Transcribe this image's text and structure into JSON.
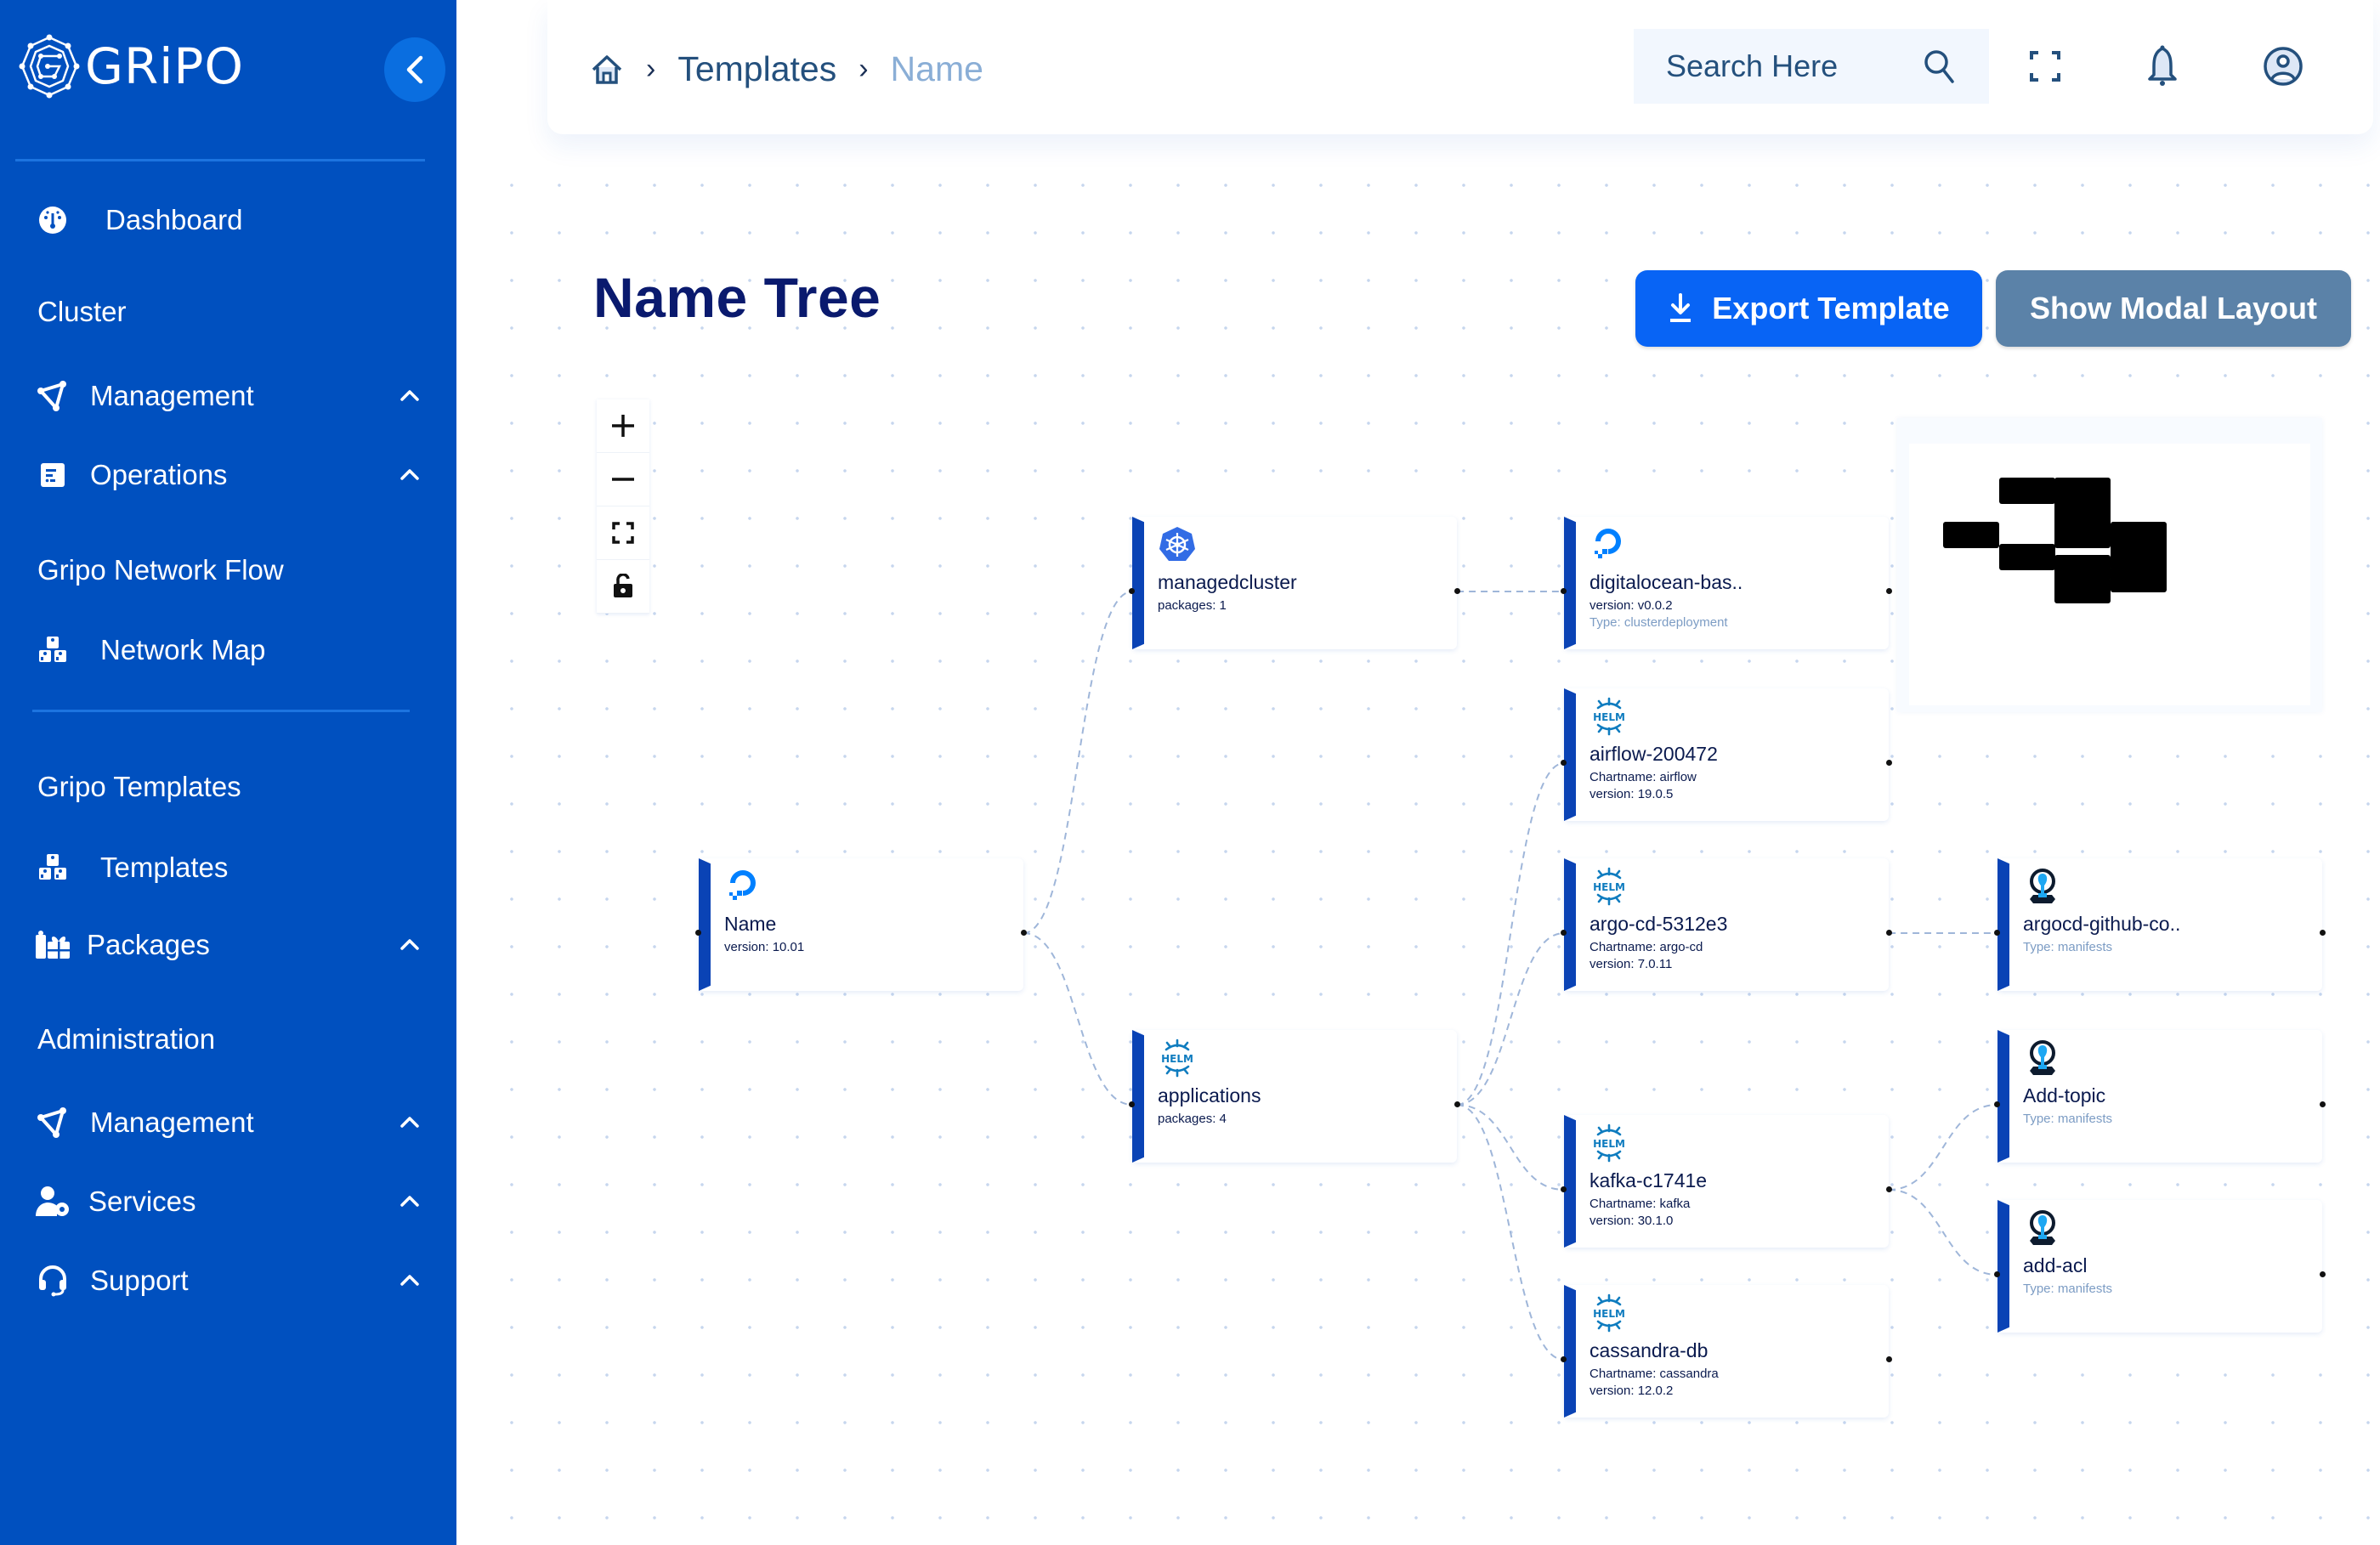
{
  "brand": {
    "name": "GRiPO"
  },
  "sidebar": {
    "dashboard": "Dashboard",
    "sections": {
      "cluster": "Cluster",
      "network_flow": "Gripo Network Flow",
      "templates": "Gripo Templates",
      "administration": "Administration"
    },
    "items": {
      "cluster_management": "Management",
      "operations": "Operations",
      "network_map": "Network Map",
      "templates": "Templates",
      "packages": "Packages",
      "admin_management": "Management",
      "services": "Services",
      "support": "Support"
    }
  },
  "header": {
    "breadcrumb": {
      "parent": "Templates",
      "current": "Name"
    },
    "search_placeholder": "Search Here"
  },
  "page": {
    "title": "Name Tree",
    "export_label": "Export Template",
    "modal_label": "Show Modal Layout"
  },
  "colors": {
    "sidebar": "#0050bf",
    "primary": "#0864f5",
    "secondary": "#5b82a8",
    "node_accent": "#0a43b5",
    "title": "#0a1a6e"
  },
  "tree": {
    "nodes": [
      {
        "id": "name",
        "icon": "digitalocean",
        "title": "Name",
        "l1": "version: 10.01",
        "l2": ""
      },
      {
        "id": "managedcluster",
        "icon": "kubernetes",
        "title": "managedcluster",
        "l1": "packages: 1",
        "l2": ""
      },
      {
        "id": "applications",
        "icon": "helm",
        "title": "applications",
        "l1": "packages: 4",
        "l2": ""
      },
      {
        "id": "digitalocean",
        "icon": "digitalocean",
        "title": "digitalocean-bas..",
        "l1": "version: v0.0.2",
        "l2": "Type: clusterdeployment",
        "l2_muted": true
      },
      {
        "id": "airflow",
        "icon": "helm",
        "title": "airflow-200472",
        "l1": "Chartname: airflow",
        "l2": "version: 19.0.5"
      },
      {
        "id": "argocd",
        "icon": "helm",
        "title": "argo-cd-5312e3",
        "l1": "Chartname: argo-cd",
        "l2": "version: 7.0.11"
      },
      {
        "id": "kafka",
        "icon": "helm",
        "title": "kafka-c1741e",
        "l1": "Chartname: kafka",
        "l2": "version: 30.1.0"
      },
      {
        "id": "cassandra",
        "icon": "helm",
        "title": "cassandra-db",
        "l1": "Chartname: cassandra",
        "l2": "version: 12.0.2"
      },
      {
        "id": "argocd-github",
        "icon": "manifest",
        "title": "argocd-github-co..",
        "l1": "Type: manifests",
        "l1_muted": true,
        "l2": ""
      },
      {
        "id": "add-topic",
        "icon": "manifest",
        "title": "Add-topic",
        "l1": "Type: manifests",
        "l1_muted": true,
        "l2": ""
      },
      {
        "id": "add-acl",
        "icon": "manifest",
        "title": "add-acl",
        "l1": "Type: manifests",
        "l1_muted": true,
        "l2": ""
      }
    ],
    "edges": [
      [
        "name",
        "managedcluster"
      ],
      [
        "name",
        "applications"
      ],
      [
        "managedcluster",
        "digitalocean"
      ],
      [
        "applications",
        "airflow"
      ],
      [
        "applications",
        "argocd"
      ],
      [
        "applications",
        "kafka"
      ],
      [
        "applications",
        "cassandra"
      ],
      [
        "argocd",
        "argocd-github"
      ],
      [
        "kafka",
        "add-topic"
      ],
      [
        "kafka",
        "add-acl"
      ]
    ]
  }
}
